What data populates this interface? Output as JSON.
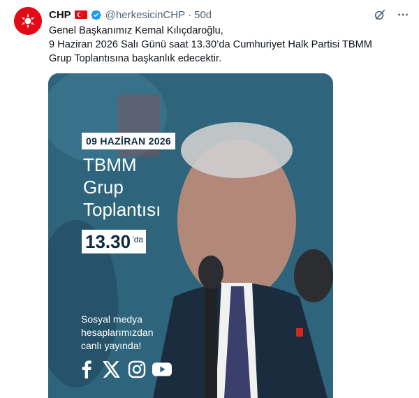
{
  "tweet": {
    "author_name": "CHP",
    "handle": "@herkesicinCHP",
    "separator": "·",
    "time": "50d",
    "text_lines": [
      "Genel Başkanımız Kemal Kılıçdaroğlu,",
      "9 Haziran 2026 Salı Günü saat 13.30’da Cumhuriyet Halk Partisi TBMM",
      "Grup Toplantısına başkanlık edecektir."
    ]
  },
  "icons": {
    "flag": "turkey-flag-icon",
    "verified": "verified-badge-icon",
    "grok": "grok-icon",
    "more": "more-options-icon"
  },
  "media": {
    "date_label": "09 HAZİRAN 2026",
    "title_lines": [
      "TBMM",
      "Grup",
      "Toplantısı"
    ],
    "time_main": "13.30",
    "time_suffix": "’da",
    "social_lines": [
      "Sosyal medya",
      "hesaplarımızdan",
      "canlı yayında!"
    ],
    "social_icons": [
      "facebook-icon",
      "x-icon",
      "instagram-icon",
      "youtube-icon"
    ]
  },
  "colors": {
    "brand_red": "#e30a17",
    "verified_blue": "#1d9bf0",
    "secondary_text": "#536471",
    "media_background": "#2b5f78"
  }
}
